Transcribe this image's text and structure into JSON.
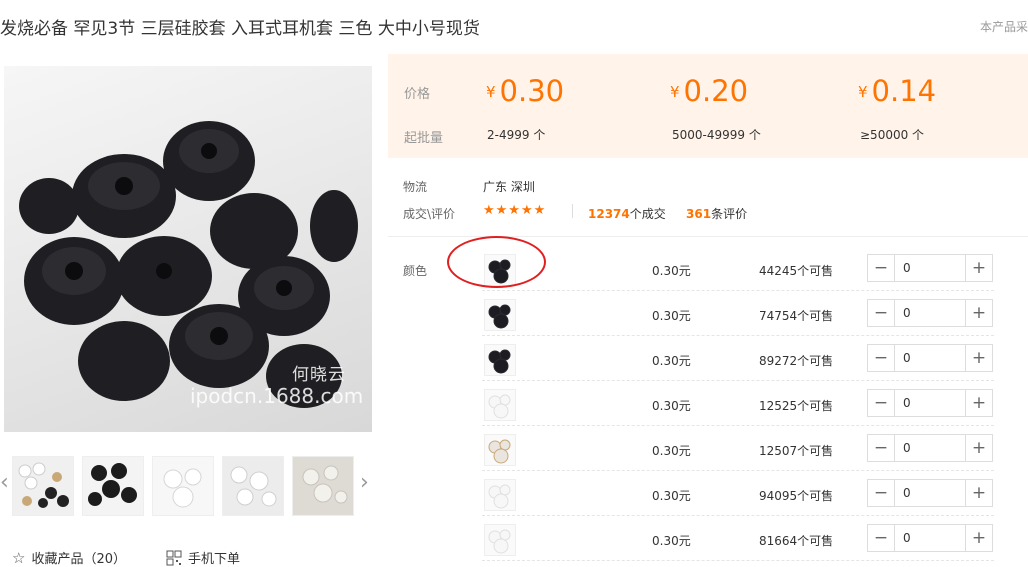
{
  "header": {
    "title": "发烧必备 罕见3节 三层硅胶套 入耳式耳机套 三色 大中小号现货",
    "right_text": "本产品采"
  },
  "gallery": {
    "watermark_name": "何晓云",
    "watermark_site": "ipodcn.1688.com",
    "next_arrow": "›",
    "prev_arrow": "‹"
  },
  "footer": {
    "favorite_label": "收藏产品（20）",
    "mobile_label": "手机下单"
  },
  "pricing": {
    "price_label": "价格",
    "moq_label": "起批量",
    "currency": "¥",
    "tiers": [
      {
        "price": "0.30",
        "qty": "2-4999 个"
      },
      {
        "price": "0.20",
        "qty": "5000-49999 个"
      },
      {
        "price": "0.14",
        "qty": "≥50000 个"
      }
    ]
  },
  "logistics": {
    "label": "物流",
    "value": "广东 深圳"
  },
  "reviews": {
    "label": "成交\\评价",
    "stars": "★★★★★",
    "deals_count": "12374",
    "deals_suffix": "个成交",
    "review_count": "361",
    "review_suffix": "条评价",
    "rating": 4.5
  },
  "variants": {
    "label": "颜色",
    "rows": [
      {
        "price": "0.30元",
        "stock": "44245个可售",
        "qty": "0",
        "swatch": "black"
      },
      {
        "price": "0.30元",
        "stock": "74754个可售",
        "qty": "0",
        "swatch": "black"
      },
      {
        "price": "0.30元",
        "stock": "89272个可售",
        "qty": "0",
        "swatch": "black"
      },
      {
        "price": "0.30元",
        "stock": "12525个可售",
        "qty": "0",
        "swatch": "white"
      },
      {
        "price": "0.30元",
        "stock": "12507个可售",
        "qty": "0",
        "swatch": "mixed"
      },
      {
        "price": "0.30元",
        "stock": "94095个可售",
        "qty": "0",
        "swatch": "white"
      },
      {
        "price": "0.30元",
        "stock": "81664个可售",
        "qty": "0",
        "swatch": "white"
      }
    ],
    "minus": "−",
    "plus": "+"
  },
  "colors": {
    "accent": "#ff7300",
    "price_bg": "#fff3ea",
    "annotation": "#e02020"
  }
}
